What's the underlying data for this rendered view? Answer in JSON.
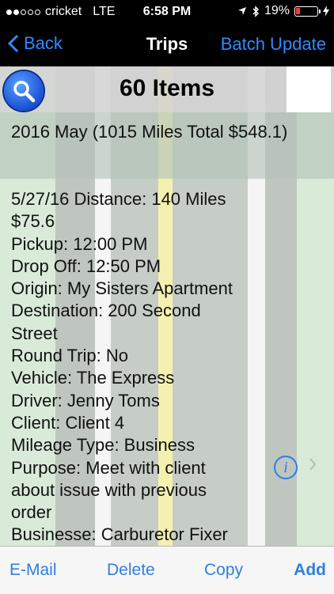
{
  "status_bar": {
    "carrier": "cricket",
    "network": "LTE",
    "time": "6:58 PM",
    "battery_percent": "19%",
    "battery_level": 0.19,
    "signal_bars": 2,
    "icons": [
      "location-arrow-icon",
      "bluetooth-icon",
      "battery-icon",
      "charging-bolt-icon"
    ]
  },
  "nav": {
    "back_label": "Back",
    "title": "Trips",
    "batch_label": "Batch Update"
  },
  "header": {
    "items_count": "60 Items",
    "search_icon": "magnifier-icon"
  },
  "section": {
    "title": "2016 May (1015 Miles Total $548.1)"
  },
  "trip": {
    "lines": [
      "5/27/16 Distance: 140 Miles",
      "$75.6",
      "Pickup: 12:00 PM",
      "Drop Off: 12:50 PM",
      "Origin: My Sisters Apartment",
      "Destination: 200 Second",
      "Street",
      "Round Trip: No",
      "Vehicle: The Express",
      "Driver: Jenny Toms",
      "Client: Client 4",
      "Mileage Type: Business",
      "Purpose: Meet with client",
      "about issue with previous",
      "order",
      "Businesse: Carburetor Fixer"
    ],
    "info_icon": "info-circle-icon",
    "chevron_icon": "chevron-right-icon"
  },
  "toolbar": {
    "email_label": "E-Mail",
    "delete_label": "Delete",
    "copy_label": "Copy",
    "add_label": "Add"
  },
  "colors": {
    "accent": "#2f7fe0",
    "nav_background": "#000000",
    "battery_low": "#ff3b30"
  }
}
